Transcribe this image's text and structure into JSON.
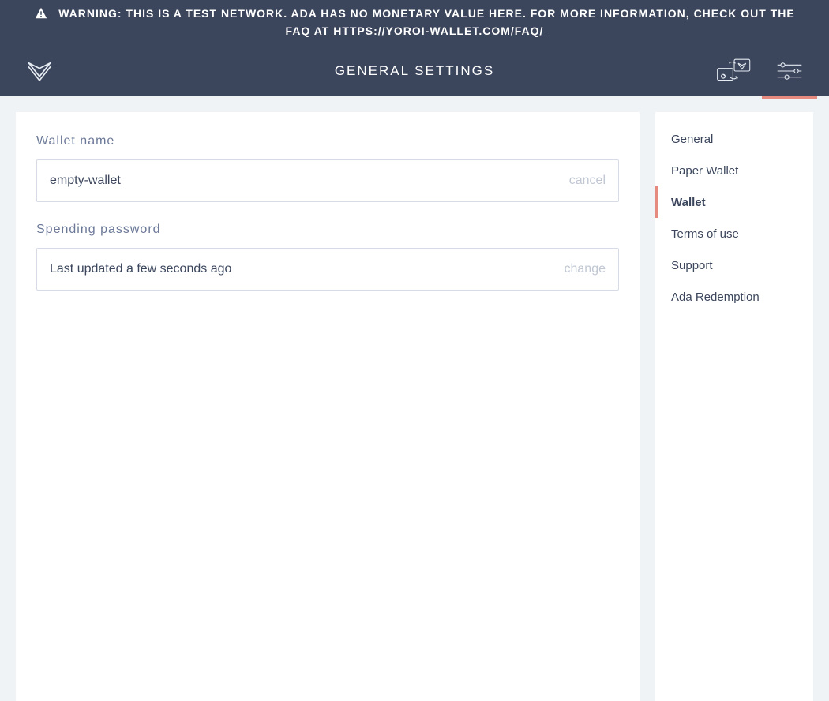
{
  "warning": {
    "text": "WARNING: THIS IS A TEST NETWORK. ADA HAS NO MONETARY VALUE HERE. FOR MORE INFORMATION, CHECK OUT THE FAQ AT ",
    "link_text": "HTTPS://YOROI-WALLET.COM/FAQ/"
  },
  "header": {
    "title": "GENERAL SETTINGS"
  },
  "wallet_name": {
    "label": "Wallet name",
    "value": "empty-wallet",
    "action": "cancel"
  },
  "spending_password": {
    "label": "Spending password",
    "status": "Last updated a few seconds ago",
    "action": "change"
  },
  "sidebar": {
    "items": [
      {
        "label": "General",
        "active": false
      },
      {
        "label": "Paper Wallet",
        "active": false
      },
      {
        "label": "Wallet",
        "active": true
      },
      {
        "label": "Terms of use",
        "active": false
      },
      {
        "label": "Support",
        "active": false
      },
      {
        "label": "Ada Redemption",
        "active": false
      }
    ]
  },
  "colors": {
    "accent": "#e6897e",
    "header_bg": "#3b465c",
    "body_bg": "#f0f3f5"
  }
}
